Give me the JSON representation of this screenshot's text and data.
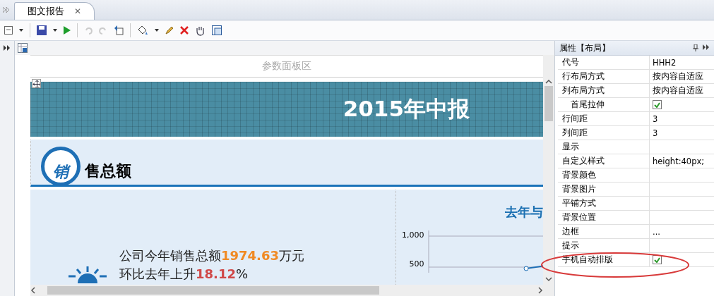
{
  "tabs": [
    {
      "label": "图文报告",
      "close": "✕",
      "selected": true
    }
  ],
  "canvas": {
    "param_area": "参数面板区",
    "banner_title": "2015年中报",
    "section_badge": "销",
    "section_title": "售总额",
    "summary": {
      "line1": "公司今年销售总额**1974.63**万元",
      "line2": "环比去年上升**18.12**%"
    },
    "chart": {
      "title": "去年与",
      "yticks": [
        "1,000",
        "500"
      ]
    }
  },
  "properties": {
    "title": "属性【布局】",
    "rows": [
      {
        "name": "代号",
        "kind": "text",
        "value": "HHH2"
      },
      {
        "name": "行布局方式",
        "kind": "text",
        "value": "按内容自适应"
      },
      {
        "name": "列布局方式",
        "kind": "text",
        "value": "按内容自适应"
      },
      {
        "name": "首尾拉伸",
        "kind": "check",
        "checked": true,
        "indent": true
      },
      {
        "name": "行间距",
        "kind": "text",
        "value": "3"
      },
      {
        "name": "列间距",
        "kind": "text",
        "value": "3"
      },
      {
        "name": "显示",
        "kind": "text"
      },
      {
        "name": "自定义样式",
        "kind": "text",
        "value": "height:40px;"
      },
      {
        "name": "背景颜色",
        "kind": "text"
      },
      {
        "name": "背景图片",
        "kind": "text"
      },
      {
        "name": "平铺方式",
        "kind": "text"
      },
      {
        "name": "背景位置",
        "kind": "text"
      },
      {
        "name": "边框",
        "kind": "text",
        "value": "..."
      },
      {
        "name": "提示",
        "kind": "text"
      },
      {
        "name": "手机自动排版",
        "kind": "check",
        "checked": true,
        "highlighted": true
      }
    ]
  }
}
